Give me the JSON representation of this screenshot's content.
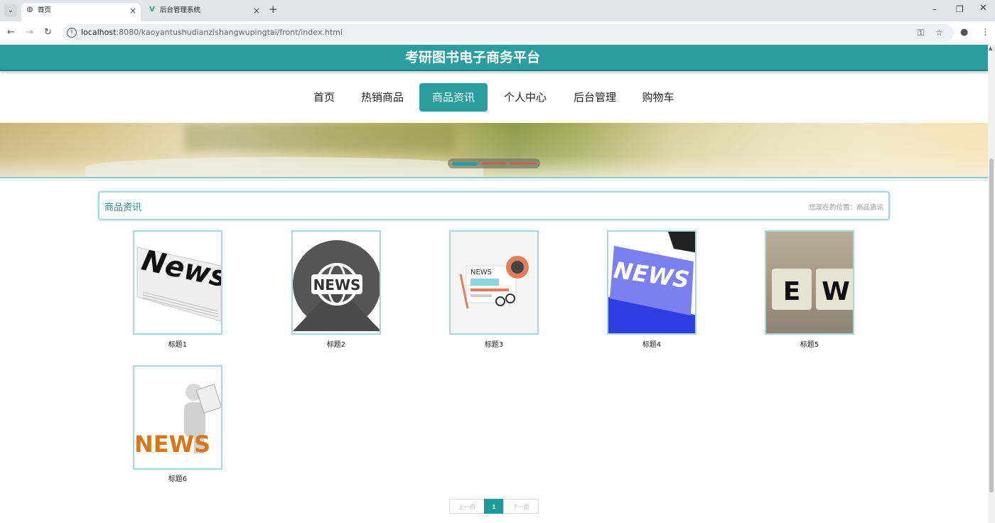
{
  "browser": {
    "tabs": [
      {
        "title": "首页",
        "active": true
      },
      {
        "title": "后台管理系统",
        "active": false
      }
    ],
    "url_host": "localhost",
    "url_rest": ":8080/kaoyantushudianzishangwupingtai/front/index.html",
    "new_tab": "+",
    "close": "×"
  },
  "site": {
    "title": "考研图书电子商务平台",
    "accent": "#2a9d9e"
  },
  "menu": [
    {
      "label": "首页"
    },
    {
      "label": "热销商品"
    },
    {
      "label": "商品资讯",
      "active": true
    },
    {
      "label": "个人中心"
    },
    {
      "label": "后台管理"
    },
    {
      "label": "购物车"
    }
  ],
  "banner": {
    "slide_count": 3,
    "active_slide": 1
  },
  "section": {
    "title": "商品资讯",
    "breadcrumb": "您现在的位置：商品资讯"
  },
  "news": [
    {
      "title": "标题1",
      "image": "newspaper-news"
    },
    {
      "title": "标题2",
      "image": "globe-news-badge"
    },
    {
      "title": "标题3",
      "image": "news-flat-illustration"
    },
    {
      "title": "标题4",
      "image": "news-blue-key"
    },
    {
      "title": "标题5",
      "image": "news-dice"
    },
    {
      "title": "标题6",
      "image": "news-3d-figure"
    }
  ],
  "pager": {
    "prev": "上一页",
    "current": "1",
    "next": "下一页"
  }
}
